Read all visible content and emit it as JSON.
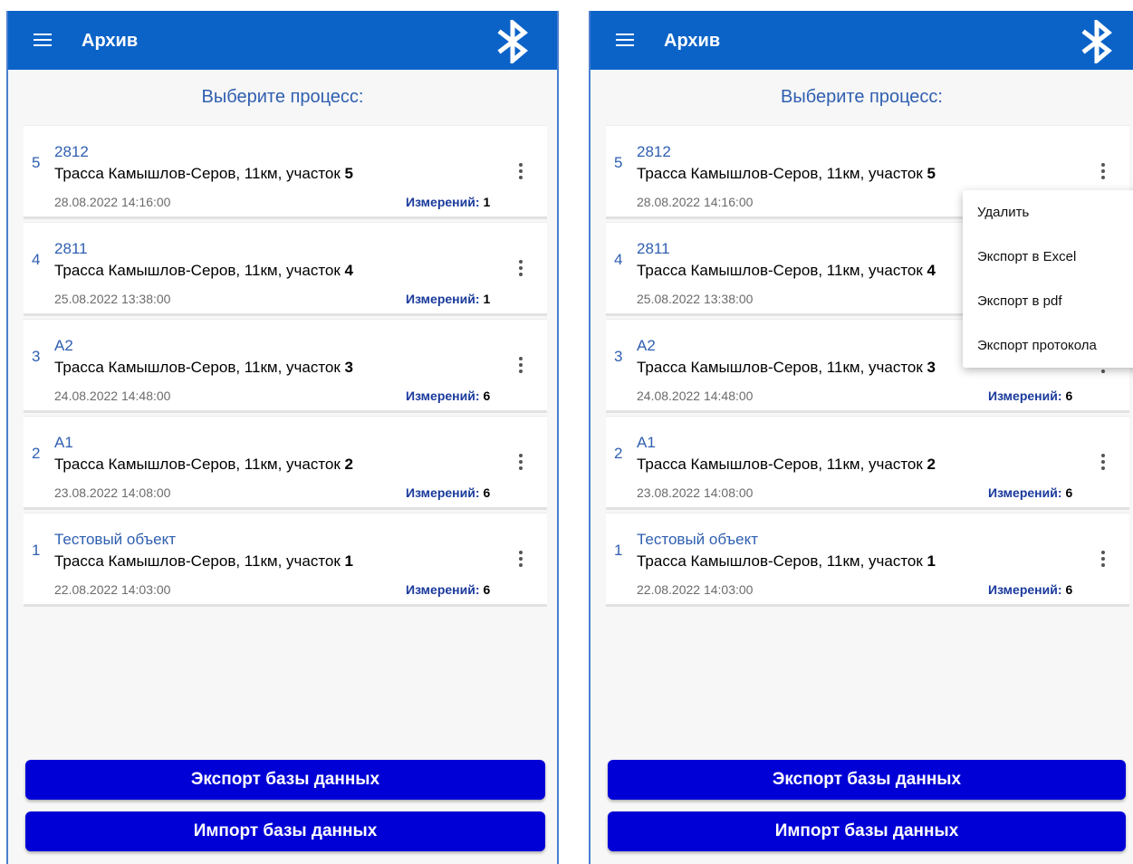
{
  "app": {
    "title": "Архив",
    "subtitle": "Выберите процесс:",
    "accent_color": "#0b63c8",
    "button_color": "#0000d6",
    "icons": [
      "menu-icon",
      "bluetooth-icon",
      "more-vert-icon"
    ]
  },
  "items": [
    {
      "index": "5",
      "name": "2812",
      "desc_prefix": "Трасса Камышлов-Серов, 11км, участок ",
      "desc_num": "5",
      "date": "28.08.2022 14:16:00",
      "meas_label": "Измерений:",
      "meas_value": "1"
    },
    {
      "index": "4",
      "name": "2811",
      "desc_prefix": "Трасса Камышлов-Серов, 11км, участок ",
      "desc_num": "4",
      "date": "25.08.2022 13:38:00",
      "meas_label": "Измерений:",
      "meas_value": "1"
    },
    {
      "index": "3",
      "name": "A2",
      "desc_prefix": "Трасса Камышлов-Серов, 11км, участок ",
      "desc_num": "3",
      "date": "24.08.2022 14:48:00",
      "meas_label": "Измерений:",
      "meas_value": "6"
    },
    {
      "index": "2",
      "name": "A1",
      "desc_prefix": "Трасса Камышлов-Серов, 11км, участок ",
      "desc_num": "2",
      "date": "23.08.2022 14:08:00",
      "meas_label": "Измерений:",
      "meas_value": "6"
    },
    {
      "index": "1",
      "name": "Тестовый объект",
      "desc_prefix": "Трасса Камышлов-Серов, 11км, участок ",
      "desc_num": "1",
      "date": "22.08.2022 14:03:00",
      "meas_label": "Измерений:",
      "meas_value": "6"
    }
  ],
  "buttons": {
    "export_db": "Экспорт базы данных",
    "import_db": "Импорт базы данных"
  },
  "context_menu": {
    "items": [
      "Удалить",
      "Экспорт в Excel",
      "Экспорт в pdf",
      "Экспорт протокола"
    ]
  }
}
